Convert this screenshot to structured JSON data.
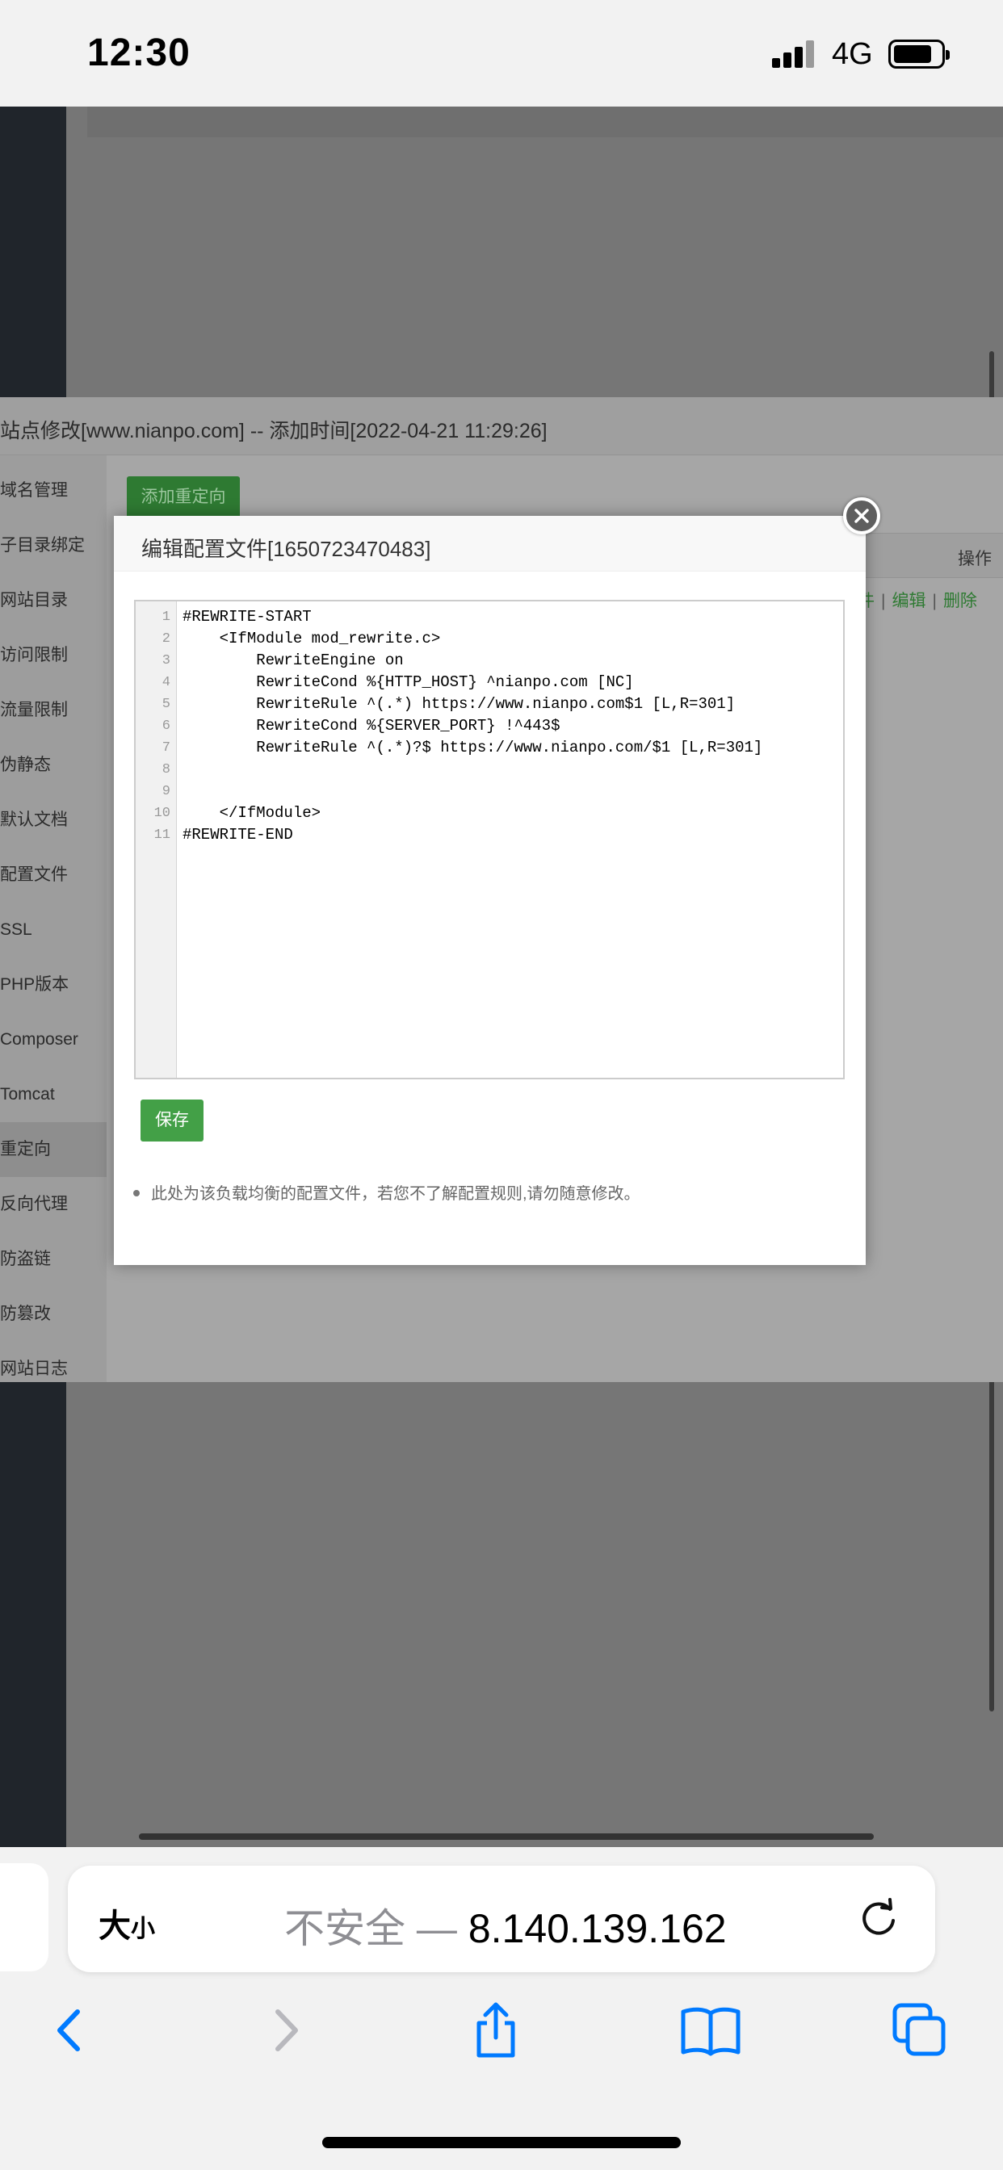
{
  "status_bar": {
    "time": "12:30",
    "network": "4G"
  },
  "site_panel": {
    "title": "站点修改[www.nianpo.com] -- 添加时间[2022-04-21 11:29:26]",
    "nav_items": [
      {
        "label": "域名管理"
      },
      {
        "label": "子目录绑定"
      },
      {
        "label": "网站目录"
      },
      {
        "label": "访问限制"
      },
      {
        "label": "流量限制"
      },
      {
        "label": "伪静态"
      },
      {
        "label": "默认文档"
      },
      {
        "label": "配置文件"
      },
      {
        "label": "SSL"
      },
      {
        "label": "PHP版本"
      },
      {
        "label": "Composer"
      },
      {
        "label": "Tomcat"
      },
      {
        "label": "重定向",
        "active": true
      },
      {
        "label": "反向代理"
      },
      {
        "label": "防盗链"
      },
      {
        "label": "防篡改"
      },
      {
        "label": "网站日志"
      }
    ],
    "add_redirect_label": "添加重定向",
    "column_operation": "操作",
    "row_action_file": "件",
    "row_action_edit": "编辑",
    "row_action_delete": "删除"
  },
  "modal": {
    "title": "编辑配置文件[1650723470483]",
    "code_lines": [
      "#REWRITE-START",
      "    <IfModule mod_rewrite.c>",
      "        RewriteEngine on",
      "        RewriteCond %{HTTP_HOST} ^nianpo.com [NC]",
      "        RewriteRule ^(.*) https://www.nianpo.com$1 [L,R=301]",
      "        RewriteCond %{SERVER_PORT} !^443$",
      "        RewriteRule ^(.*)?$ https://www.nianpo.com/$1 [L,R=301]",
      "",
      "",
      "    </IfModule>",
      "#REWRITE-END"
    ],
    "line_numbers": [
      "1",
      "2",
      "3",
      "4",
      "5",
      "6",
      "7",
      "8",
      "9",
      "10",
      "11"
    ],
    "save_label": "保存",
    "tip": "此处为该负载均衡的配置文件，若您不了解配置规则,请勿随意修改。"
  },
  "safari": {
    "text_size_label": "大",
    "text_size_small": "小",
    "insecure_label": "不安全 —",
    "address": "8.140.139.162"
  },
  "icons": {
    "close": "close-icon",
    "reload": "reload-icon",
    "back": "chevron-left-icon",
    "forward": "chevron-right-icon",
    "share": "share-icon",
    "bookmarks": "book-icon",
    "tabs": "tabs-icon"
  },
  "colors": {
    "accent_green": "#43a047",
    "ios_blue": "#007aff"
  }
}
